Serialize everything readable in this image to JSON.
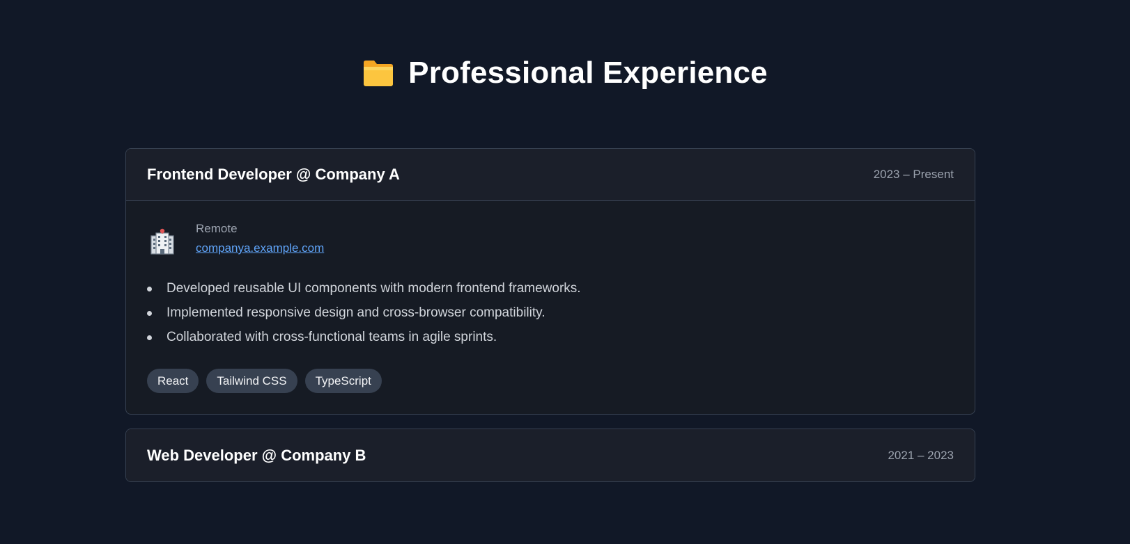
{
  "header": {
    "icon": "folder-icon",
    "title": "Professional Experience"
  },
  "experiences": [
    {
      "role": "Frontend Developer @ Company A",
      "dates": "2023 – Present",
      "expanded": true,
      "location": "Remote",
      "website": "companya.example.com",
      "icon": "office-building-icon",
      "bullets": [
        "Developed reusable UI components with modern frontend frameworks.",
        "Implemented responsive design and cross-browser compatibility.",
        "Collaborated with cross-functional teams in agile sprints."
      ],
      "tags": [
        "React",
        "Tailwind CSS",
        "TypeScript"
      ]
    },
    {
      "role": "Web Developer @ Company B",
      "dates": "2021 – 2023",
      "expanded": false
    }
  ],
  "colors": {
    "background": "#111827",
    "card_border": "#374151",
    "link": "#60a5fa",
    "tag_bg": "#374151"
  }
}
